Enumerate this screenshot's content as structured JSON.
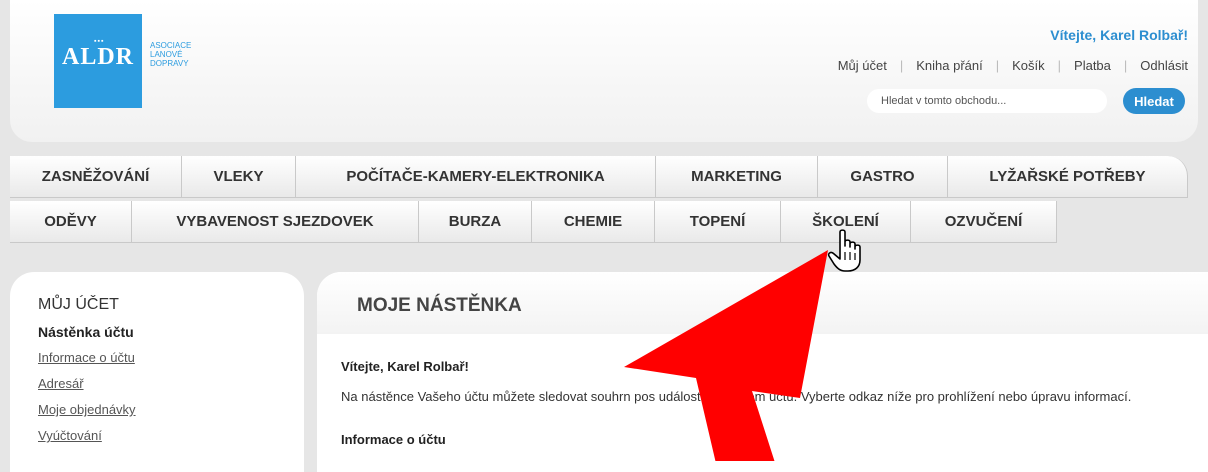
{
  "header": {
    "logo_mark": "ALDR",
    "logo_lines": [
      "ASOCIACE",
      "LANOVÉ",
      "DOPRAVY"
    ],
    "welcome": "Vítejte, Karel Rolbař!",
    "top_links": [
      "Můj účet",
      "Kniha přání",
      "Košík",
      "Platba",
      "Odhlásit"
    ],
    "search_placeholder": "Hledat v tomto obchodu...",
    "search_button": "Hledat"
  },
  "nav": {
    "row1": [
      "ZASNĚŽOVÁNÍ",
      "VLEKY",
      "POČÍTAČE-KAMERY-ELEKTRONIKA",
      "MARKETING",
      "GASTRO",
      "LYŽAŘSKÉ POTŘEBY"
    ],
    "row2": [
      "ODĚVY",
      "VYBAVENOST SJEZDOVEK",
      "BURZA",
      "CHEMIE",
      "TOPENÍ",
      "ŠKOLENÍ",
      "OZVUČENÍ"
    ]
  },
  "sidebar": {
    "title": "MŮJ ÚČET",
    "active": "Nástěnka účtu",
    "links": [
      "Informace o účtu",
      "Adresář",
      "Moje objednávky",
      "Vyúčtování"
    ]
  },
  "main": {
    "title": "MOJE NÁSTĚNKA",
    "greeting": "Vítejte, Karel Rolbař!",
    "intro": "Na nástěnce Vašeho účtu můžete sledovat souhrn pos          událostí na Vašem účtu. Vyberte odkaz níže pro prohlížení nebo úpravu informací.",
    "section": "Informace o účtu"
  },
  "colors": {
    "accent": "#2c8ed0",
    "logo": "#2c9cdf",
    "arrow": "#ff0000"
  },
  "overlay_icons": [
    "hand-pointer-cursor-icon",
    "red-arrow-annotation"
  ]
}
